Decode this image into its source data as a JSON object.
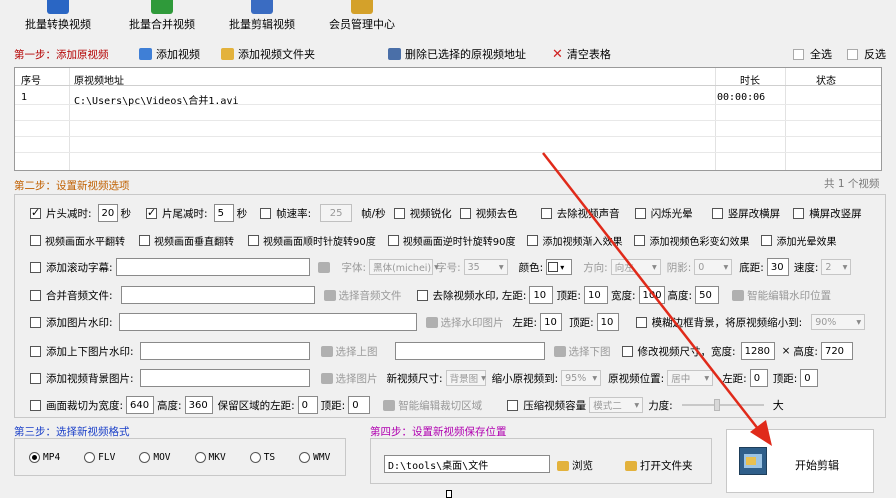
{
  "toolbar": {
    "items": [
      {
        "label": "批量转换视频",
        "color": "#2a66c4"
      },
      {
        "label": "批量合并视频",
        "color": "#2f9a3a"
      },
      {
        "label": "批量剪辑视频",
        "color": "#3a6cc2"
      },
      {
        "label": "会员管理中心",
        "color": "#d4a12a"
      }
    ]
  },
  "step1": {
    "title": "第一步：添加原视频",
    "add_video": "添加视频",
    "add_folder": "添加视频文件夹",
    "delete_selected": "删除已选择的原视频地址",
    "clear_table": "清空表格",
    "select_all": "全选",
    "invert": "反选"
  },
  "table": {
    "headers": {
      "index": "序号",
      "path": "原视频地址",
      "duration": "时长",
      "status": "状态"
    },
    "rows": [
      {
        "index": "1",
        "path": "C:\\Users\\pc\\Videos\\合并1.avi",
        "duration": "00:00:06",
        "status": ""
      }
    ],
    "count_text": "共 1 个视频"
  },
  "step2": {
    "title": "第二步：设置新视频选项",
    "row1": {
      "head_cut": "片头减时:",
      "head_val": "20",
      "sec1": "秒",
      "tail_cut": "片尾减时:",
      "tail_val": "5",
      "sec2": "秒",
      "fps": "帧速率:",
      "fps_val": "25",
      "fps_unit": "帧/秒",
      "sharpen": "视频锐化",
      "decolor": "视频去色",
      "remove_audio": "去除视频声音",
      "flash": "闪烁光晕",
      "v2h": "竖屏改横屏",
      "h2v": "横屏改竖屏"
    },
    "row2": {
      "hflip": "视频画面水平翻转",
      "vflip": "视频画面垂直翻转",
      "rot_cw": "视频画面顺时针旋转90度",
      "rot_ccw": "视频画面逆时针旋转90度",
      "fade_in": "添加视频渐入效果",
      "color_fx": "添加视频色彩变幻效果",
      "light_fx": "添加光晕效果"
    },
    "row3": {
      "subtitle": "添加滚动字幕:",
      "font_label": "字体:",
      "font_val": "黑体(michei)",
      "size_label": "字号:",
      "size_val": "35",
      "color_label": "颜色:",
      "dir_label": "方向:",
      "dir_val": "向左",
      "shadow_label": "阴影:",
      "shadow_val": "0",
      "bottom_label": "底距:",
      "bottom_val": "30",
      "speed_label": "速度:",
      "speed_val": "2"
    },
    "row4": {
      "merge_audio": "合并音频文件:",
      "choose_audio": "选择音频文件",
      "remove_wm": "去除视频水印,",
      "left_label": "左距:",
      "left_val": "10",
      "top_label": "顶距:",
      "top_val": "10",
      "width_label": "宽度:",
      "width_val": "100",
      "height_label": "高度:",
      "height_val": "50",
      "smart_wm": "智能编辑水印位置"
    },
    "row5": {
      "img_wm": "添加图片水印:",
      "choose_wm": "选择水印图片",
      "left_label": "左距:",
      "left_val": "10",
      "top_label": "顶距:",
      "top_val": "10",
      "blur_bg": "模糊边框背景，将原视频缩小到:",
      "blur_val": "90%"
    },
    "row6": {
      "tb_wm": "添加上下图片水印:",
      "choose_top": "选择上图",
      "choose_bottom": "选择下图",
      "resize": "修改视频尺寸，宽度:",
      "w_val": "1280",
      "times": "×",
      "h_label": "高度:",
      "h_val": "720"
    },
    "row7": {
      "bg_img": "添加视频背景图片:",
      "choose_img": "选择图片",
      "size_label": "新视频尺寸:",
      "size_val": "背景图",
      "shrink_label": "缩小原视频到:",
      "shrink_val": "95%",
      "pos_label": "原视频位置:",
      "pos_val": "居中",
      "left_label": "左距:",
      "left_val": "0",
      "top_label": "顶距:",
      "top_val": "0"
    },
    "row8": {
      "crop": "画面裁切为宽度:",
      "crop_w": "640",
      "h_label": "高度:",
      "crop_h": "360",
      "keep_label": "保留区域的左距:",
      "left_val": "0",
      "top_label": "顶距:",
      "top_val": "0",
      "smart_crop": "智能编辑裁切区域",
      "compress": "压缩视频容量",
      "mode_val": "模式二",
      "strength": "力度:",
      "big": "大"
    }
  },
  "step3": {
    "title": "第三步：选择新视频格式",
    "formats": [
      "MP4",
      "FLV",
      "MOV",
      "MKV",
      "TS",
      "WMV"
    ],
    "selected": "MP4"
  },
  "step4": {
    "title": "第四步：设置新视频保存位置",
    "path": "D:\\tools\\桌面\\文件",
    "browse": "浏览",
    "open_folder": "打开文件夹"
  },
  "start": {
    "label": "开始剪辑"
  },
  "colors": {
    "arrow": "#e02a1a",
    "step1": "#b40000",
    "step2": "#c06000",
    "step3": "#1a3fc8",
    "step4": "#b000b0"
  }
}
